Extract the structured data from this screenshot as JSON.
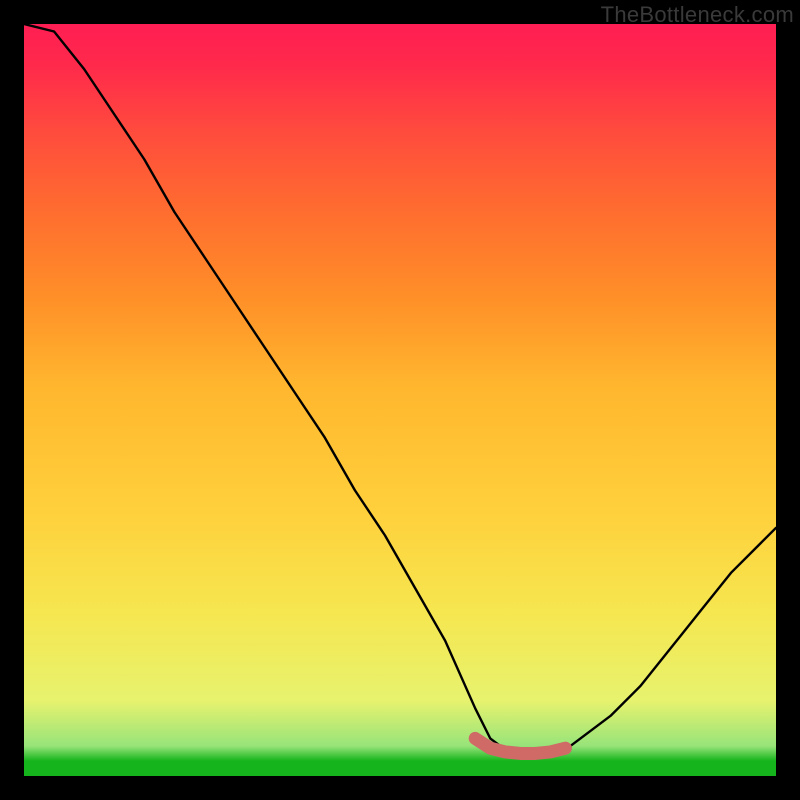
{
  "watermark": {
    "text": "TheBottleneck.com"
  },
  "colors": {
    "curve": "#000000",
    "curve_marker": "#cf6a66",
    "curve_marker_stroke": "#b35752"
  },
  "chart_data": {
    "type": "line",
    "title": "",
    "xlabel": "",
    "ylabel": "",
    "xlim": [
      0,
      100
    ],
    "ylim": [
      0,
      100
    ],
    "grid": false,
    "legend": null,
    "note": "Values are approximate, read from the plotted curve against the implicit 0–100 axes (no tick labels are shown in the image). The curve is a V-shape: steep near-linear descent from top-left down to a flat minimum around x≈62–72 at y≈3, then a moderate rise toward the right edge reaching y≈33 at x=100.",
    "series": [
      {
        "name": "curve",
        "x": [
          0,
          4,
          8,
          12,
          16,
          20,
          24,
          28,
          32,
          36,
          40,
          44,
          48,
          52,
          56,
          60,
          62,
          64,
          66,
          68,
          70,
          72,
          74,
          78,
          82,
          86,
          90,
          94,
          98,
          100
        ],
        "values": [
          100,
          99,
          94,
          88,
          82,
          75,
          69,
          63,
          57,
          51,
          45,
          38,
          32,
          25,
          18,
          9,
          5,
          3.5,
          3,
          3,
          3,
          3.5,
          5,
          8,
          12,
          17,
          22,
          27,
          31,
          33
        ]
      }
    ],
    "marker_segment": {
      "note": "Short coral/pink thick segment tracing the flat bottom of the V (the optimum region).",
      "x": [
        60,
        62,
        64,
        66,
        68,
        70,
        72
      ],
      "values": [
        5,
        3.7,
        3.2,
        3,
        3,
        3.2,
        3.7
      ]
    }
  }
}
